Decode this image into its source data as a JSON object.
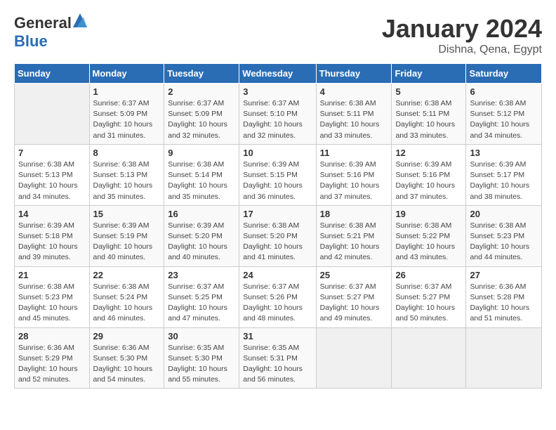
{
  "header": {
    "logo_general": "General",
    "logo_blue": "Blue",
    "month_year": "January 2024",
    "location": "Dishna, Qena, Egypt"
  },
  "days_of_week": [
    "Sunday",
    "Monday",
    "Tuesday",
    "Wednesday",
    "Thursday",
    "Friday",
    "Saturday"
  ],
  "weeks": [
    [
      {
        "day": "",
        "info": ""
      },
      {
        "day": "1",
        "info": "Sunrise: 6:37 AM\nSunset: 5:09 PM\nDaylight: 10 hours\nand 31 minutes."
      },
      {
        "day": "2",
        "info": "Sunrise: 6:37 AM\nSunset: 5:09 PM\nDaylight: 10 hours\nand 32 minutes."
      },
      {
        "day": "3",
        "info": "Sunrise: 6:37 AM\nSunset: 5:10 PM\nDaylight: 10 hours\nand 32 minutes."
      },
      {
        "day": "4",
        "info": "Sunrise: 6:38 AM\nSunset: 5:11 PM\nDaylight: 10 hours\nand 33 minutes."
      },
      {
        "day": "5",
        "info": "Sunrise: 6:38 AM\nSunset: 5:11 PM\nDaylight: 10 hours\nand 33 minutes."
      },
      {
        "day": "6",
        "info": "Sunrise: 6:38 AM\nSunset: 5:12 PM\nDaylight: 10 hours\nand 34 minutes."
      }
    ],
    [
      {
        "day": "7",
        "info": "Sunrise: 6:38 AM\nSunset: 5:13 PM\nDaylight: 10 hours\nand 34 minutes."
      },
      {
        "day": "8",
        "info": "Sunrise: 6:38 AM\nSunset: 5:13 PM\nDaylight: 10 hours\nand 35 minutes."
      },
      {
        "day": "9",
        "info": "Sunrise: 6:38 AM\nSunset: 5:14 PM\nDaylight: 10 hours\nand 35 minutes."
      },
      {
        "day": "10",
        "info": "Sunrise: 6:39 AM\nSunset: 5:15 PM\nDaylight: 10 hours\nand 36 minutes."
      },
      {
        "day": "11",
        "info": "Sunrise: 6:39 AM\nSunset: 5:16 PM\nDaylight: 10 hours\nand 37 minutes."
      },
      {
        "day": "12",
        "info": "Sunrise: 6:39 AM\nSunset: 5:16 PM\nDaylight: 10 hours\nand 37 minutes."
      },
      {
        "day": "13",
        "info": "Sunrise: 6:39 AM\nSunset: 5:17 PM\nDaylight: 10 hours\nand 38 minutes."
      }
    ],
    [
      {
        "day": "14",
        "info": "Sunrise: 6:39 AM\nSunset: 5:18 PM\nDaylight: 10 hours\nand 39 minutes."
      },
      {
        "day": "15",
        "info": "Sunrise: 6:39 AM\nSunset: 5:19 PM\nDaylight: 10 hours\nand 40 minutes."
      },
      {
        "day": "16",
        "info": "Sunrise: 6:39 AM\nSunset: 5:20 PM\nDaylight: 10 hours\nand 40 minutes."
      },
      {
        "day": "17",
        "info": "Sunrise: 6:38 AM\nSunset: 5:20 PM\nDaylight: 10 hours\nand 41 minutes."
      },
      {
        "day": "18",
        "info": "Sunrise: 6:38 AM\nSunset: 5:21 PM\nDaylight: 10 hours\nand 42 minutes."
      },
      {
        "day": "19",
        "info": "Sunrise: 6:38 AM\nSunset: 5:22 PM\nDaylight: 10 hours\nand 43 minutes."
      },
      {
        "day": "20",
        "info": "Sunrise: 6:38 AM\nSunset: 5:23 PM\nDaylight: 10 hours\nand 44 minutes."
      }
    ],
    [
      {
        "day": "21",
        "info": "Sunrise: 6:38 AM\nSunset: 5:23 PM\nDaylight: 10 hours\nand 45 minutes."
      },
      {
        "day": "22",
        "info": "Sunrise: 6:38 AM\nSunset: 5:24 PM\nDaylight: 10 hours\nand 46 minutes."
      },
      {
        "day": "23",
        "info": "Sunrise: 6:37 AM\nSunset: 5:25 PM\nDaylight: 10 hours\nand 47 minutes."
      },
      {
        "day": "24",
        "info": "Sunrise: 6:37 AM\nSunset: 5:26 PM\nDaylight: 10 hours\nand 48 minutes."
      },
      {
        "day": "25",
        "info": "Sunrise: 6:37 AM\nSunset: 5:27 PM\nDaylight: 10 hours\nand 49 minutes."
      },
      {
        "day": "26",
        "info": "Sunrise: 6:37 AM\nSunset: 5:27 PM\nDaylight: 10 hours\nand 50 minutes."
      },
      {
        "day": "27",
        "info": "Sunrise: 6:36 AM\nSunset: 5:28 PM\nDaylight: 10 hours\nand 51 minutes."
      }
    ],
    [
      {
        "day": "28",
        "info": "Sunrise: 6:36 AM\nSunset: 5:29 PM\nDaylight: 10 hours\nand 52 minutes."
      },
      {
        "day": "29",
        "info": "Sunrise: 6:36 AM\nSunset: 5:30 PM\nDaylight: 10 hours\nand 54 minutes."
      },
      {
        "day": "30",
        "info": "Sunrise: 6:35 AM\nSunset: 5:30 PM\nDaylight: 10 hours\nand 55 minutes."
      },
      {
        "day": "31",
        "info": "Sunrise: 6:35 AM\nSunset: 5:31 PM\nDaylight: 10 hours\nand 56 minutes."
      },
      {
        "day": "",
        "info": ""
      },
      {
        "day": "",
        "info": ""
      },
      {
        "day": "",
        "info": ""
      }
    ]
  ]
}
